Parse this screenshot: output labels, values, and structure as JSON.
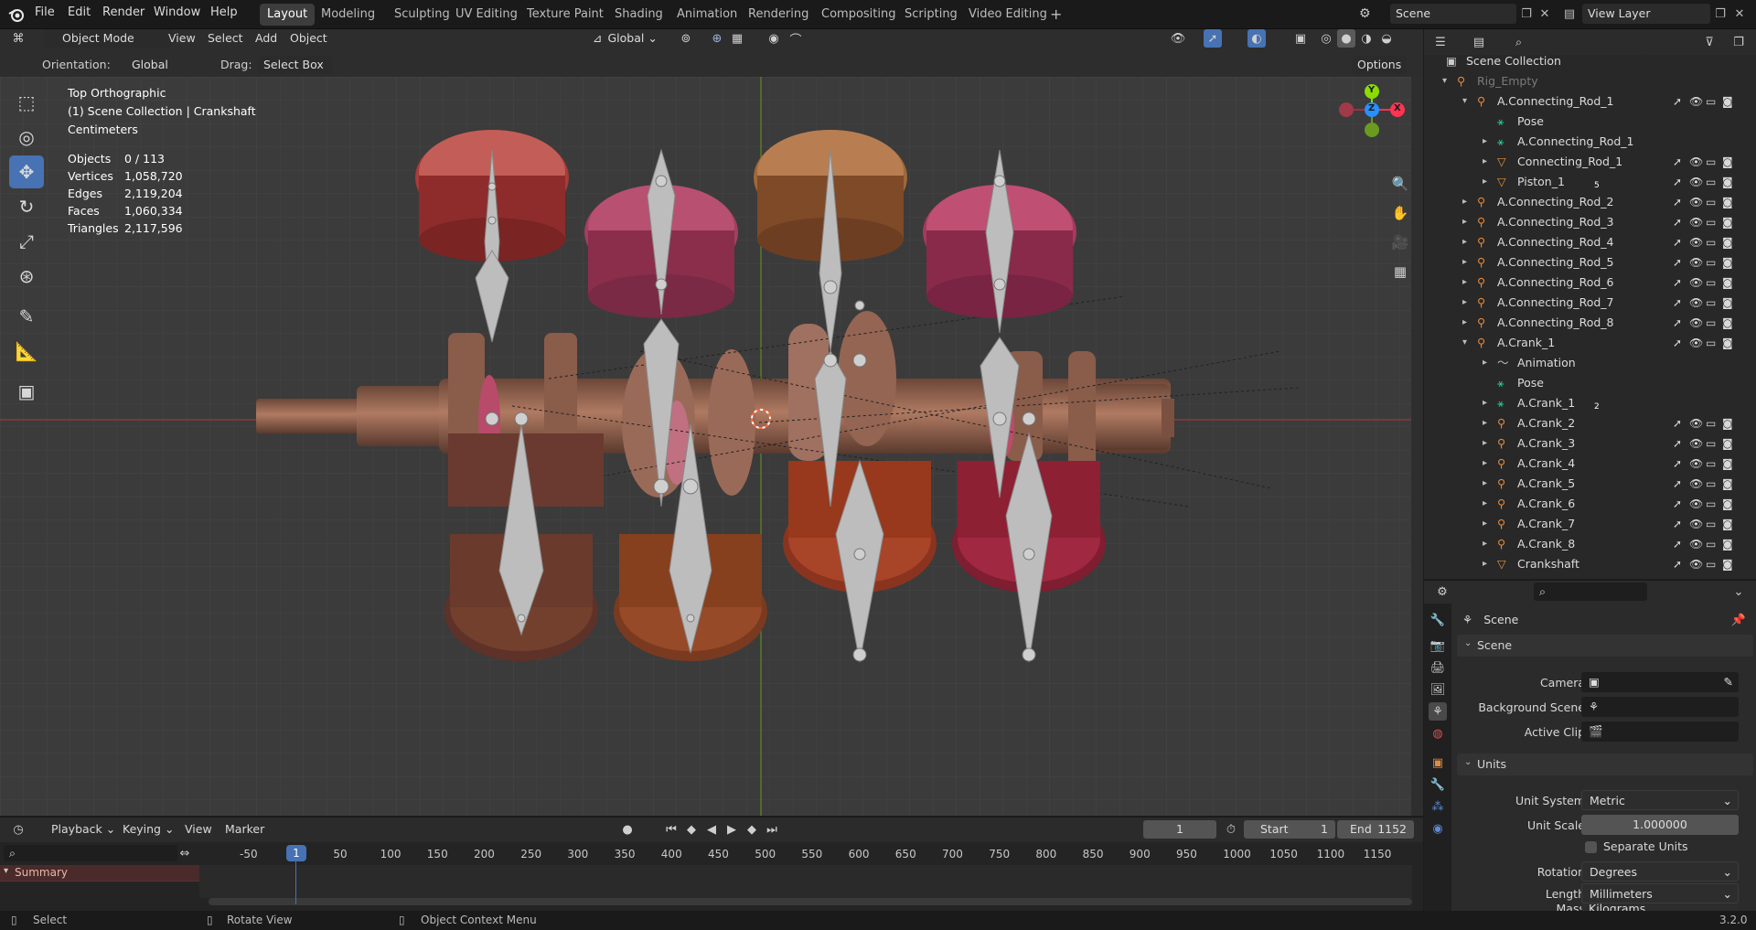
{
  "topbar": {
    "menus": [
      "File",
      "Edit",
      "Render",
      "Window",
      "Help"
    ],
    "workspaces": [
      "Layout",
      "Modeling",
      "Sculpting",
      "UV Editing",
      "Texture Paint",
      "Shading",
      "Animation",
      "Rendering",
      "Compositing",
      "Scripting",
      "Video Editing"
    ],
    "active_workspace": "Layout",
    "scene_name": "Scene",
    "view_layer": "View Layer"
  },
  "viewport_header": {
    "mode": "Object Mode",
    "menus": [
      "View",
      "Select",
      "Add",
      "Object"
    ],
    "transform_orientation": "Global",
    "orientation_label": "Orientation:",
    "orientation_value": "Global",
    "drag_label": "Drag:",
    "drag_value": "Select Box",
    "options_label": "Options"
  },
  "overlay": {
    "view_name": "Top Orthographic",
    "collection": "(1) Scene Collection | Crankshaft",
    "units": "Centimeters",
    "stats": [
      {
        "label": "Objects",
        "value": "0 / 113"
      },
      {
        "label": "Vertices",
        "value": "1,058,720"
      },
      {
        "label": "Edges",
        "value": "2,119,204"
      },
      {
        "label": "Faces",
        "value": "1,060,334"
      },
      {
        "label": "Triangles",
        "value": "2,117,596"
      }
    ],
    "gizmo_axes": {
      "y": "Y",
      "z": "Z",
      "x": "X"
    }
  },
  "outliner": {
    "root": "Scene Collection",
    "rows": [
      {
        "label": "Rig_Empty",
        "indent": 1,
        "dim": true
      },
      {
        "label": "A.Connecting_Rod_1",
        "indent": 2
      },
      {
        "label": "Pose",
        "indent": 3
      },
      {
        "label": "A.Connecting_Rod_1",
        "indent": 3
      },
      {
        "label": "Connecting_Rod_1",
        "indent": 3
      },
      {
        "label": "Piston_1",
        "indent": 3,
        "badge": "5"
      },
      {
        "label": "A.Connecting_Rod_2",
        "indent": 2
      },
      {
        "label": "A.Connecting_Rod_3",
        "indent": 2
      },
      {
        "label": "A.Connecting_Rod_4",
        "indent": 2
      },
      {
        "label": "A.Connecting_Rod_5",
        "indent": 2
      },
      {
        "label": "A.Connecting_Rod_6",
        "indent": 2
      },
      {
        "label": "A.Connecting_Rod_7",
        "indent": 2
      },
      {
        "label": "A.Connecting_Rod_8",
        "indent": 2
      },
      {
        "label": "A.Crank_1",
        "indent": 2
      },
      {
        "label": "Animation",
        "indent": 3
      },
      {
        "label": "Pose",
        "indent": 3
      },
      {
        "label": "A.Crank_1",
        "indent": 3,
        "badge": "2"
      },
      {
        "label": "A.Crank_2",
        "indent": 3
      },
      {
        "label": "A.Crank_3",
        "indent": 3
      },
      {
        "label": "A.Crank_4",
        "indent": 3
      },
      {
        "label": "A.Crank_5",
        "indent": 3
      },
      {
        "label": "A.Crank_6",
        "indent": 3
      },
      {
        "label": "A.Crank_7",
        "indent": 3
      },
      {
        "label": "A.Crank_8",
        "indent": 3
      },
      {
        "label": "Crankshaft",
        "indent": 3
      }
    ]
  },
  "properties": {
    "context": "Scene",
    "scene_panel": "Scene",
    "camera_label": "Camera",
    "background_label": "Background Scene",
    "active_clip_label": "Active Clip",
    "units_panel": "Units",
    "unit_system_label": "Unit System",
    "unit_system_value": "Metric",
    "unit_scale_label": "Unit Scale",
    "unit_scale_value": "1.000000",
    "separate_units_label": "Separate Units",
    "rotation_label": "Rotation",
    "rotation_value": "Degrees",
    "length_label": "Length",
    "length_value": "Millimeters",
    "mass_label": "Mass",
    "mass_value": "Kilograms"
  },
  "timeline": {
    "menus": [
      "Playback",
      "Keying",
      "View",
      "Marker"
    ],
    "current_frame": "1",
    "start_label": "Start",
    "start_value": "1",
    "end_label": "End",
    "end_value": "1152",
    "ticks": [
      "-50",
      "1",
      "50",
      "100",
      "150",
      "200",
      "250",
      "300",
      "350",
      "400",
      "450",
      "500",
      "550",
      "600",
      "650",
      "700",
      "750",
      "800",
      "850",
      "900",
      "950",
      "1000",
      "1050",
      "1100",
      "1150"
    ],
    "summary": "Summary"
  },
  "statusbar": {
    "select": "Select",
    "rotate": "Rotate View",
    "context": "Object Context Menu",
    "version": "3.2.0"
  },
  "colors": {
    "accent": "#4772b3",
    "x_axis": "#ff3352",
    "y_axis": "#8bdc00",
    "z_axis": "#2890ff",
    "bone": "#c8c8c8",
    "armature_icon": "#e58a3c",
    "mesh_icon": "#e0943a",
    "data_icon": "#29c99e"
  }
}
